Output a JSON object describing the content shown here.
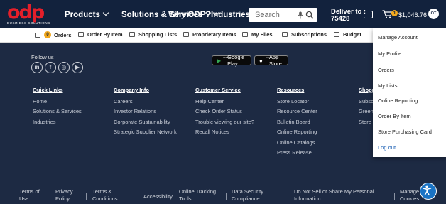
{
  "header": {
    "logo_text": "odp",
    "logo_tagline": "BUSINESS SOLUTIONS",
    "nav": [
      "Products",
      "Solutions & Services",
      "Why ODP?",
      "Industries"
    ],
    "search_placeholder": "Search",
    "deliver_label": "Deliver to :",
    "deliver_zip": "75428",
    "cart_count": "1",
    "cart_total": "$1,046.76",
    "avatar_initials": "OT"
  },
  "subnav": {
    "orders_badge": "0",
    "items": [
      "Orders",
      "Order By Item",
      "Shopping Lists",
      "Proprietary Items",
      "My Files",
      "Subscriptions",
      "Budget"
    ]
  },
  "footer": {
    "follow_label": "Follow us",
    "social": [
      "in",
      "f",
      "◎",
      "▶"
    ],
    "google_play_tiny": "GET IT ON",
    "google_play": "Google Play",
    "app_store_tiny": "Download on the",
    "app_store": "App Store",
    "columns": [
      {
        "heading": "Quick Links",
        "items": [
          "Home",
          "Solutions & Services",
          "Industries"
        ]
      },
      {
        "heading": "Company Info",
        "items": [
          "Careers",
          "Investor Relations",
          "Corporate Sustainability",
          "Strategic Supplier Network"
        ]
      },
      {
        "heading": "Customer Service",
        "items": [
          "Help Center",
          "Check Order Status",
          "Trouble viewing our site?",
          "Recall Notices"
        ]
      },
      {
        "heading": "Resources",
        "items": [
          "Store Locator",
          "Resource Center",
          "Bulletin Board",
          "Online Reporting",
          "Online Catalogs",
          "Press Release"
        ]
      },
      {
        "heading": "Shopp",
        "items": [
          "Subscr",
          "Greene",
          "Store F"
        ]
      }
    ],
    "bottom_links": [
      {
        "l1": "Terms of",
        "l2": "Use"
      },
      {
        "l1": "Privacy",
        "l2": "Policy"
      },
      {
        "l1": "Terms &",
        "l2": "Conditions"
      },
      {
        "l1": "Accessibility",
        "l2": ""
      },
      {
        "l1": "Online Tracking",
        "l2": "Tools"
      },
      {
        "l1": "Data Security",
        "l2": "Compliance"
      },
      {
        "l1": "Do Not Sell or Share My Personal",
        "l2": "Information"
      },
      {
        "l1": "Manage",
        "l2": "Cookies"
      }
    ]
  },
  "account_menu": {
    "items": [
      "Manage Account",
      "My Profile",
      "Orders",
      "My Lists",
      "Online Reporting",
      "Order By Item",
      "Store Purchasing Card",
      "Log out"
    ]
  },
  "colors": {
    "header_bg": "#12223d",
    "footer_bg": "#1d2a43",
    "brand_red": "#e41f2a",
    "badge": "#f2a81d",
    "link_blue": "#1a5fb4"
  }
}
